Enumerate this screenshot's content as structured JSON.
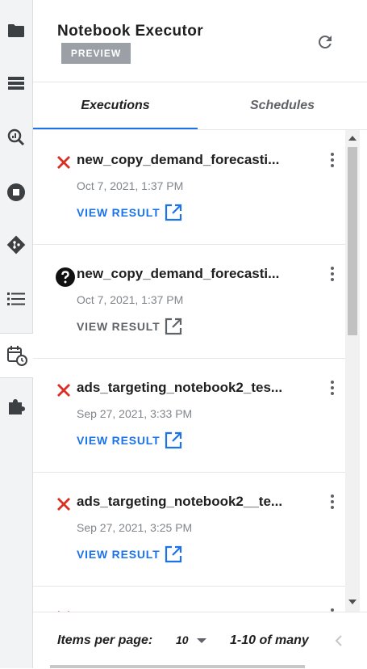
{
  "sidebar": {
    "icons": [
      "folder-icon",
      "storage-icon",
      "query-insights-icon",
      "stop-circle-icon",
      "git-icon",
      "list-icon",
      "scheduled-calendar-icon",
      "extension-icon"
    ]
  },
  "header": {
    "title": "Notebook Executor",
    "badge": "PREVIEW",
    "refresh_icon": "refresh-icon"
  },
  "tabs": [
    {
      "label": "Executions",
      "active": true
    },
    {
      "label": "Schedules",
      "active": false
    }
  ],
  "executions": [
    {
      "status": "failed",
      "name": "new_copy_demand_forecasti...",
      "date": "Oct 7, 2021, 1:37 PM",
      "link_label": "VIEW RESULT",
      "link_enabled": true
    },
    {
      "status": "unknown",
      "name": "new_copy_demand_forecasti...",
      "date": "Oct 7, 2021, 1:37 PM",
      "link_label": "VIEW RESULT",
      "link_enabled": false
    },
    {
      "status": "failed",
      "name": "ads_targeting_notebook2_tes...",
      "date": "Sep 27, 2021, 3:33 PM",
      "link_label": "VIEW RESULT",
      "link_enabled": true
    },
    {
      "status": "failed",
      "name": "ads_targeting_notebook2__te...",
      "date": "Sep 27, 2021, 3:25 PM",
      "link_label": "VIEW RESULT",
      "link_enabled": true
    }
  ],
  "pagination": {
    "items_per_page_label": "Items per page:",
    "items_per_page_value": "10",
    "range_label": "1-10 of many"
  },
  "colors": {
    "accent": "#1a73e8",
    "error": "#d93025",
    "disabled": "#5f6368",
    "badge": "#9aa0a6"
  }
}
